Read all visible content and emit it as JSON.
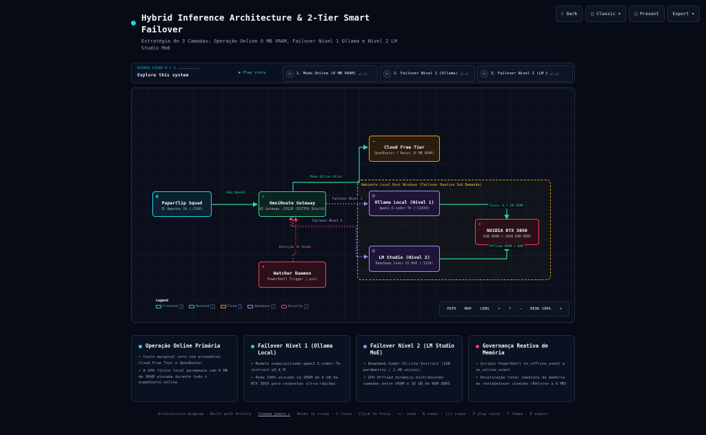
{
  "header": {
    "title": "Hybrid Inference Architecture & 2-Tier Smart Failover",
    "subtitle": "Estratégia de 3 Camadas: Operação Online 0 MB VRAM, Failover Nível 1 Ollama e Nível 2 LM Studio MoE"
  },
  "topbar": {
    "dark": "☾ Dark",
    "classic": "▢ Classic ▾",
    "present": "▢ Present",
    "export": "Export ▾"
  },
  "guided": {
    "kicker": "GUIDED VIEWS 0 / 3",
    "explore": "Explore this system",
    "play": "▶ Play story",
    "steps": [
      {
        "num": "01",
        "label": "1. Modo Online (0 MB VRAM)",
        "meta": "▪5 ▪3 ◦"
      },
      {
        "num": "02",
        "label": "2. Failover Nível 1 (Ollama)",
        "meta": "▪5 ▪5 ◦"
      },
      {
        "num": "03",
        "label": "3. Failover Nível 2 (LM Stu…",
        "meta": "▪5 ▪3 ◦"
      }
    ]
  },
  "diagram": {
    "group_label": "Ambiente Local Host Windows (Failover Reativo Sob Demanda)",
    "nodes": {
      "paperclip": {
        "title": "PaperClip Squad",
        "sub": "15 Agentes IA (:3100)",
        "icon": "▣"
      },
      "omniroute": {
        "title": "OmniRoute Gateway",
        "sub": "AI Gateway :20128 (DSITE4 Shield)",
        "icon": "◇"
      },
      "cloud": {
        "title": "Cloud Free Tier",
        "sub": "OpenRouter / Nexus (0 MB VRAM)",
        "icon": "☁"
      },
      "ollama": {
        "title": "Ollama Local (Nível 1)",
        "sub": "qwen2.5-coder:7b (:11434)",
        "icon": "▤"
      },
      "lmstudio": {
        "title": "LM Studio (Nível 2)",
        "sub": "DeepSeek Coder V2 MoE (:1234)",
        "icon": "▤"
      },
      "nvidia": {
        "title": "NVIDIA RTX 3050",
        "sub": "6GB VRAM + 16GB RAM DDR5",
        "icon": "◈"
      },
      "watcher": {
        "title": "Watcher Daemon",
        "sub": "PowerShell Trigger (.ps1)",
        "icon": "◈"
      }
    },
    "edges": {
      "req_openai": "Req OpenAI",
      "modo_online": "Modo Online Ativo",
      "failover1": "Failover Nível 1",
      "failover2": "Failover Nível 2",
      "deteccao": "Detecção de Queda",
      "aloca": "Aloca ~4.7 GB VRAM",
      "offload": "Offload VRAM + RAM"
    }
  },
  "legend": {
    "title": "Legend",
    "items": [
      {
        "label": "Frontend",
        "count": "1",
        "color": "#22d3ee"
      },
      {
        "label": "Backend",
        "count": "1",
        "color": "#34d399"
      },
      {
        "label": "Cloud",
        "count": "1",
        "color": "#f59e0b"
      },
      {
        "label": "Database",
        "count": "2",
        "color": "#a78bfa"
      },
      {
        "label": "Security",
        "count": "2",
        "color": "#f43f5e"
      }
    ]
  },
  "toolbar": {
    "path": "PATH",
    "map": "MAP",
    "lens": "LENS",
    "search": "⌕",
    "help": "?",
    "minus": "−",
    "zoom": "READ 100%",
    "plus": "+"
  },
  "cards": [
    {
      "title": "Operação Online Primária",
      "color": "#22d3ee",
      "bullets": [
        "• Custo marginal zero com provedores Cloud Free Tier e OpenRouter",
        "• A GPU física local permanece com 0 MB de VRAM alocada durante todo o expediente online"
      ]
    },
    {
      "title": "Failover Nível 1 (Ollama Local)",
      "color": "#34d399",
      "bullets": [
        "• Modelo especializado qwen2.5-coder:7b-instruct-q4_K_M",
        "• Roda 100% alocado na VRAM de 6 GB da RTX 3050 para respostas ultra-rápidas"
      ]
    },
    {
      "title": "Failover Nível 2 (LM Studio MoE)",
      "color": "#a78bfa",
      "bullets": [
        "• DeepSeek-Coder-V2-Lite-Instruct (16B parâmetros / 2.4B ativos)",
        "• GPU Offload dinâmico distribuindo camadas entre VRAM e 16 GB de RAM DDR5"
      ]
    },
    {
      "title": "Governança Reativa de Memória",
      "color": "#f43f5e",
      "bullets": [
        "• Scripts PowerShell on_offline_event e on_online_event",
        "• Desalocação total imediata de memória ao restabelecer conexão (Retorno a 0 MB)"
      ]
    }
  ],
  "footer": {
    "made": "Architecture diagram · Built with Archify ·",
    "create": "Create yours ↗",
    "hints": "· Hover to trace · S route · Click to focus · +/− zoom · R radar · [/] views · P play story · T theme · E export"
  }
}
